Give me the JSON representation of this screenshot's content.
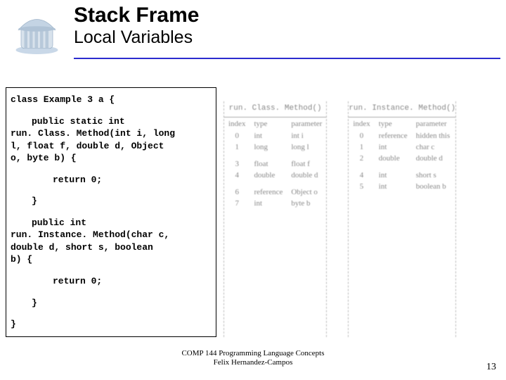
{
  "header": {
    "title": "Stack Frame",
    "subtitle": "Local Variables"
  },
  "code": {
    "l1": "class Example 3 a {",
    "l2a": "public static int",
    "l2b": "run. Class. Method(int i, long",
    "l2c": "l, float f, double d, Object",
    "l2d": "o, byte b) {",
    "l3": "return 0;",
    "l4": "}",
    "l5a": "public int",
    "l5b": "run. Instance. Method(char c,",
    "l5c": "double d, short s, boolean",
    "l5d": "b) {",
    "l6": "return 0;",
    "l7": "}",
    "l8": "}"
  },
  "table_left": {
    "heading": "run. Class. Method()",
    "h_index": "index",
    "h_type": "type",
    "h_param": "parameter",
    "rows": [
      {
        "i": "0",
        "t": "int",
        "p": "int i"
      },
      {
        "i": "1",
        "t": "long",
        "p": "long l"
      },
      {
        "i": "3",
        "t": "float",
        "p": "float f"
      },
      {
        "i": "4",
        "t": "double",
        "p": "double d"
      },
      {
        "i": "6",
        "t": "reference",
        "p": "Object o"
      },
      {
        "i": "7",
        "t": "int",
        "p": "byte b"
      }
    ]
  },
  "table_right": {
    "heading": "run. Instance. Method()",
    "h_index": "index",
    "h_type": "type",
    "h_param": "parameter",
    "rows": [
      {
        "i": "0",
        "t": "reference",
        "p": "hidden this"
      },
      {
        "i": "1",
        "t": "int",
        "p": "char c"
      },
      {
        "i": "2",
        "t": "double",
        "p": "double d"
      },
      {
        "i": "4",
        "t": "int",
        "p": "short s"
      },
      {
        "i": "5",
        "t": "int",
        "p": "boolean b"
      }
    ]
  },
  "footer": {
    "line1": "COMP 144 Programming Language Concepts",
    "line2": "Felix Hernandez-Campos"
  },
  "page_number": "13"
}
